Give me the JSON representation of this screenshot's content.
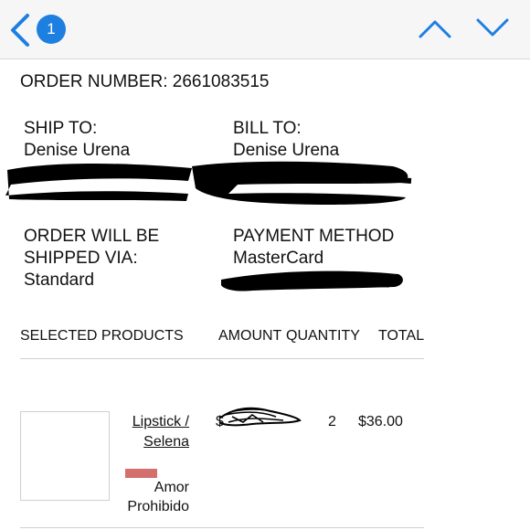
{
  "header": {
    "unread_count": "1"
  },
  "order": {
    "number_line": "ORDER NUMBER: 2661083515"
  },
  "ship_to": {
    "label": "SHIP TO:",
    "name": "Denise Urena"
  },
  "bill_to": {
    "label": "BILL TO:",
    "name": "Denise Urena"
  },
  "shipping": {
    "label_line1": "ORDER WILL BE",
    "label_line2": "SHIPPED VIA:",
    "value": "Standard"
  },
  "payment": {
    "label": "PAYMENT METHOD",
    "value": "MasterCard"
  },
  "table": {
    "headers": {
      "products": "SELECTED PRODUCTS",
      "amount": "AMOUNT",
      "quantity": "QUANTITY",
      "total": "TOTAL"
    },
    "rows": [
      {
        "product": "Lipstick / Selena",
        "variant": "Amor Prohibido",
        "swatch_color": "#d36f6d",
        "amount": "$",
        "quantity": "2",
        "total": "$36.00"
      }
    ]
  },
  "colors": {
    "accent": "#1d7fe0",
    "redaction": "#000000"
  },
  "icons": {
    "back": "chevron-left-icon",
    "up": "chevron-up-icon",
    "down": "chevron-down-icon"
  }
}
